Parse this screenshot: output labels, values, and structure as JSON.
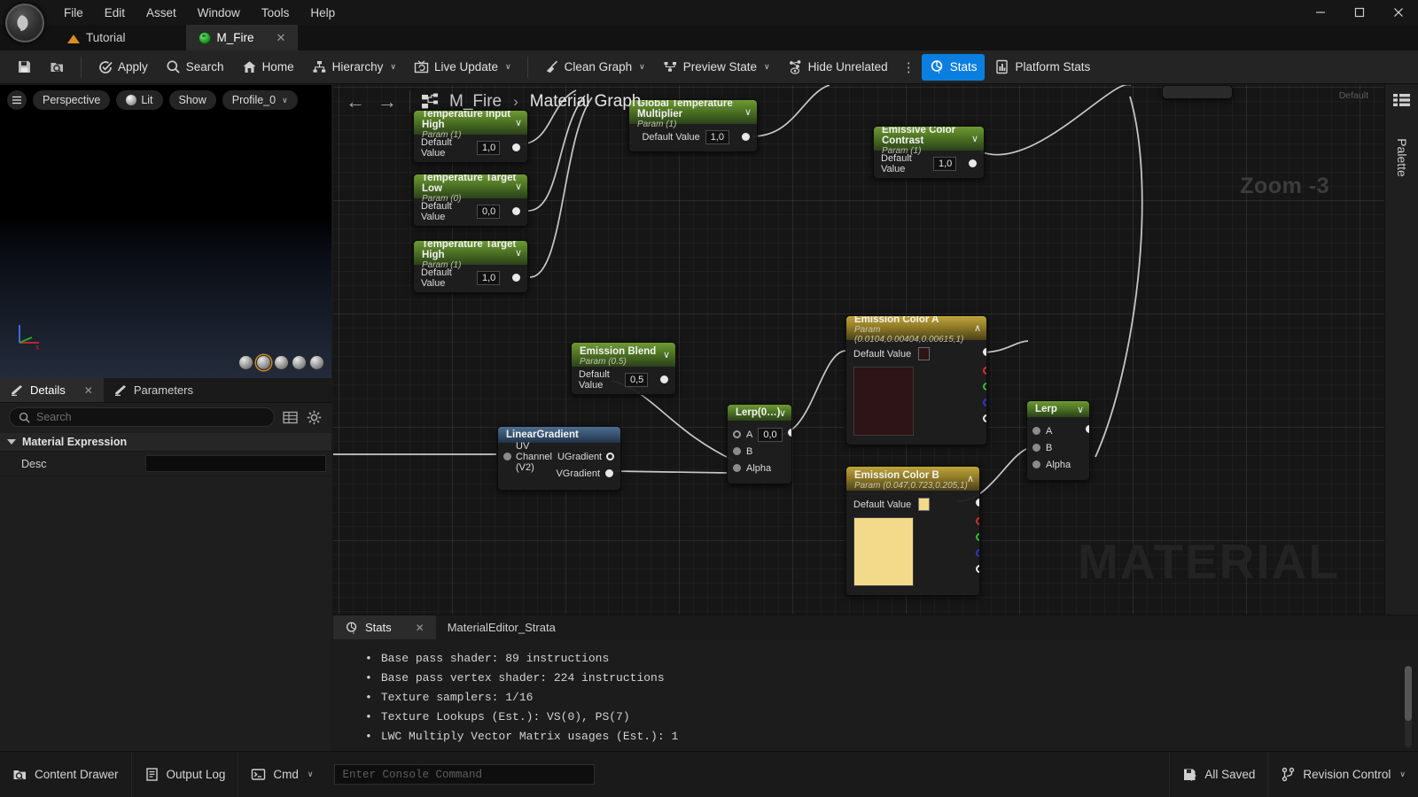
{
  "window": {
    "minimize_label": "—",
    "maximize_label": "❐",
    "close_label": "✕"
  },
  "menubar": {
    "items": [
      {
        "label": "File"
      },
      {
        "label": "Edit"
      },
      {
        "label": "Asset"
      },
      {
        "label": "Window"
      },
      {
        "label": "Tools"
      },
      {
        "label": "Help"
      }
    ]
  },
  "tabs": {
    "level_tab": {
      "label": "Tutorial",
      "icon": "landscape-icon"
    },
    "asset_tab": {
      "label": "M_Fire",
      "icon": "material-sphere-icon",
      "close": "✕"
    }
  },
  "toolbar": {
    "save_icon": "save-icon",
    "browse_icon": "browse-to-asset-icon",
    "apply": "Apply",
    "search": "Search",
    "home": "Home",
    "hierarchy": "Hierarchy",
    "live_update": "Live Update",
    "clean_graph": "Clean Graph",
    "preview_state": "Preview State",
    "hide_unrelated": "Hide Unrelated",
    "overflow": "⋮",
    "stats": "Stats",
    "platform_stats": "Platform Stats",
    "caret": "∨"
  },
  "viewport": {
    "menu_icon": "hamburger-icon",
    "perspective": "Perspective",
    "lit": "Lit",
    "show": "Show",
    "profile": "Profile_0",
    "caret": "∨",
    "axis_x": "x",
    "preview_shapes": [
      "cylinder-preview",
      "sphere-preview",
      "plane-preview",
      "cube-preview",
      "custom-mesh-preview"
    ]
  },
  "details": {
    "tab_details": "Details",
    "tab_details_close": "✕",
    "tab_parameters": "Parameters",
    "search_placeholder": "Search",
    "grid_icon": "column-settings-icon",
    "settings_icon": "gear-icon",
    "category": "Material Expression",
    "rows": [
      {
        "name": "Desc",
        "value": ""
      }
    ]
  },
  "graph": {
    "back_arrow": "←",
    "forward_arrow": "→",
    "graph_icon": "material-graph-icon",
    "breadcrumb_asset": "M_Fire",
    "breadcrumb_sep": "›",
    "breadcrumb_page": "Material Graph",
    "zoom_label": "Zoom -3",
    "default_label": "Default",
    "watermark": "MATERIAL",
    "palette_label": "Palette",
    "palette_icon": "palette-list-icon"
  },
  "nodes": [
    {
      "id": "temperature-input-high",
      "title": "Temperature Input High",
      "subtitle": "Param (1)",
      "header_color": "green",
      "value_label": "Default Value",
      "value": "1,0",
      "chevron": "∨"
    },
    {
      "id": "temperature-target-low",
      "title": "Temperature Target Low",
      "subtitle": "Param (0)",
      "header_color": "green",
      "value_label": "Default Value",
      "value": "0,0",
      "chevron": "∨"
    },
    {
      "id": "temperature-target-high",
      "title": "Temperature Target High",
      "subtitle": "Param (1)",
      "header_color": "green",
      "value_label": "Default Value",
      "value": "1,0",
      "chevron": "∨"
    },
    {
      "id": "global-temperature-multiplier",
      "title": "Global Temperature Multiplier",
      "subtitle": "Param (1)",
      "header_color": "green",
      "value_label": "Default Value",
      "value": "1,0",
      "chevron": "∨"
    },
    {
      "id": "emissive-color-contrast",
      "title": "Emissive Color Contrast",
      "subtitle": "Param (1)",
      "header_color": "green",
      "value_label": "Default Value",
      "value": "1,0",
      "chevron": "∨"
    },
    {
      "id": "emission-blend",
      "title": "Emission Blend",
      "subtitle": "Param (0.5)",
      "header_color": "green",
      "value_label": "Default Value",
      "value": "0,5",
      "chevron": "∨"
    },
    {
      "id": "emission-color-a",
      "title": "Emission Color A",
      "subtitle": "Param (0.0104,0.00404,0.00615,1)",
      "header_color": "gold",
      "value_label": "Default Value",
      "swatch_color": "#2e1416",
      "chevron": "∧"
    },
    {
      "id": "emission-color-b",
      "title": "Emission Color B",
      "subtitle": "Param (0.047,0.723,0.205,1)",
      "header_color": "gold",
      "value_label": "Default Value",
      "swatch_color": "#f3d98a",
      "chevron": "∧"
    },
    {
      "id": "linear-gradient",
      "title": "LinearGradient",
      "header_color": "blue",
      "input_label": "UV Channel (V2)",
      "out_u": "UGradient",
      "out_v": "VGradient"
    },
    {
      "id": "lerp-0",
      "title": "Lerp(0…)",
      "header_color": "green",
      "chevron": "∨",
      "pin_a": "A",
      "pin_a_value": "0,0",
      "pin_b": "B",
      "pin_alpha": "Alpha"
    },
    {
      "id": "lerp",
      "title": "Lerp",
      "header_color": "green",
      "chevron": "∨",
      "pin_a": "A",
      "pin_b": "B",
      "pin_alpha": "Alpha"
    }
  ],
  "stats": {
    "tab_stats": "Stats",
    "tab_stats_close": "✕",
    "tab_strata": "MaterialEditor_Strata",
    "lines": [
      "Base pass shader: 89 instructions",
      "Base pass vertex shader: 224 instructions",
      "Texture samplers: 1/16",
      "Texture Lookups (Est.): VS(0), PS(7)",
      "LWC Multiply Vector Matrix usages (Est.): 1"
    ],
    "bullet": "•"
  },
  "statusbar": {
    "content_drawer": "Content Drawer",
    "output_log": "Output Log",
    "cmd": "Cmd",
    "cmd_caret": "∨",
    "console_placeholder": "Enter Console Command",
    "all_saved": "All Saved",
    "revision_control": "Revision Control",
    "revision_caret": "∨"
  },
  "colors": {
    "accent": "#0b7fe0",
    "param_green": "#4c7223",
    "param_gold": "#8d7826",
    "node_blue": "#35506b",
    "emission_a": "#2e1416",
    "emission_b": "#f3d98a"
  }
}
